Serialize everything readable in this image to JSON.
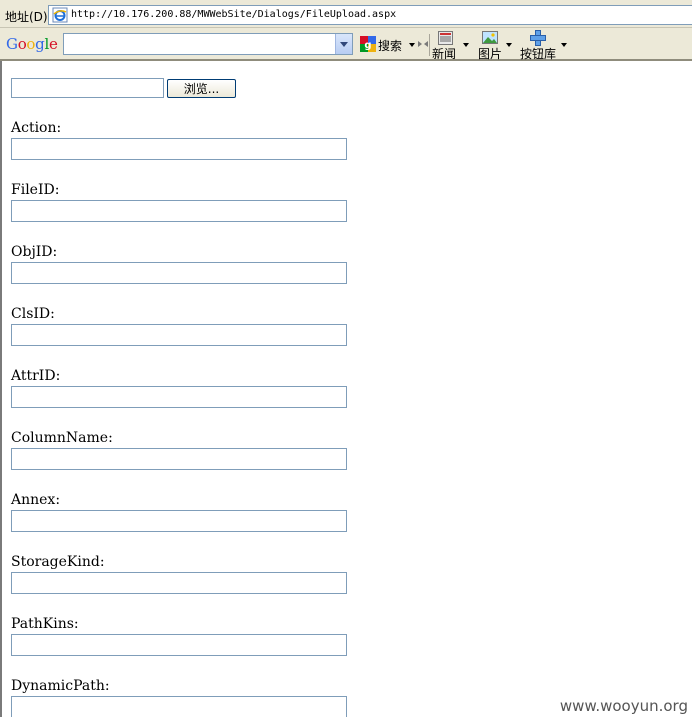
{
  "address_bar": {
    "label": "地址(D)",
    "url": "http://10.176.200.88/MWWebSite/Dialogs/FileUpload.aspx"
  },
  "google_toolbar": {
    "logo": [
      "G",
      "o",
      "o",
      "g",
      "l",
      "e"
    ],
    "logo_colors": [
      "#3369e8",
      "#d50f25",
      "#eeb211",
      "#3369e8",
      "#009925",
      "#d50f25"
    ],
    "search_value": "",
    "search_button": "搜索",
    "news_button": "新闻",
    "images_button": "图片",
    "button_gallery": "按钮库"
  },
  "upload": {
    "file_path": "",
    "browse_label": "浏览..."
  },
  "fields": [
    {
      "label": "Action:",
      "value": ""
    },
    {
      "label": "FileID:",
      "value": ""
    },
    {
      "label": "ObjID:",
      "value": ""
    },
    {
      "label": "ClsID:",
      "value": ""
    },
    {
      "label": "AttrID:",
      "value": ""
    },
    {
      "label": "ColumnName:",
      "value": ""
    },
    {
      "label": "Annex:",
      "value": ""
    },
    {
      "label": "StorageKind:",
      "value": ""
    },
    {
      "label": "PathKins:",
      "value": ""
    },
    {
      "label": "DynamicPath:",
      "value": ""
    }
  ],
  "watermark": "www.wooyun.org"
}
